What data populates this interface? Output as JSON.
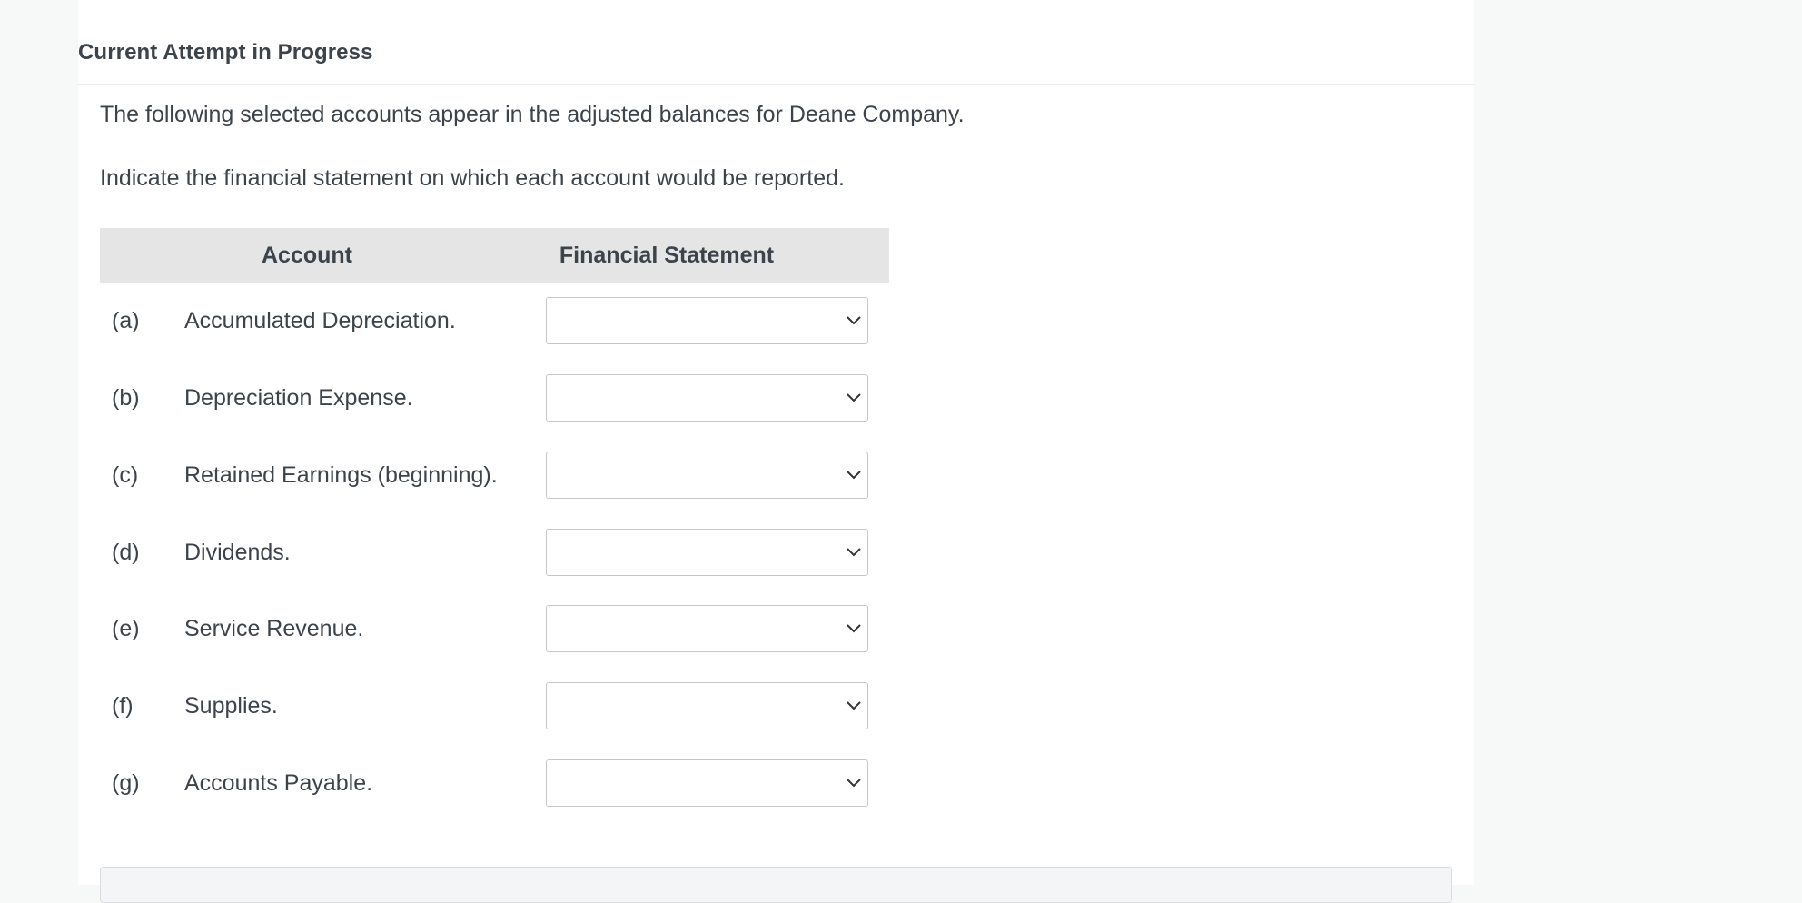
{
  "header": {
    "title": "Current Attempt in Progress"
  },
  "question": {
    "intro": "The following selected accounts appear in the adjusted balances for Deane Company.",
    "instruction": "Indicate the financial statement on which each account would be reported."
  },
  "table": {
    "columns": [
      "Account",
      "Financial Statement"
    ],
    "rows": [
      {
        "letter": "(a)",
        "account": "Accumulated Depreciation.",
        "selected": ""
      },
      {
        "letter": "(b)",
        "account": "Depreciation Expense.",
        "selected": ""
      },
      {
        "letter": "(c)",
        "account": "Retained Earnings (beginning).",
        "selected": ""
      },
      {
        "letter": "(d)",
        "account": "Dividends.",
        "selected": ""
      },
      {
        "letter": "(e)",
        "account": "Service Revenue.",
        "selected": ""
      },
      {
        "letter": "(f)",
        "account": "Supplies.",
        "selected": ""
      },
      {
        "letter": "(g)",
        "account": "Accounts Payable.",
        "selected": ""
      }
    ]
  },
  "icons": {
    "dropdown": "chevron-down-icon"
  },
  "colors": {
    "page_background": "#f7f8f8",
    "panel_background": "#ffffff",
    "table_header_background": "#e5e5e5",
    "text": "#3c434a"
  }
}
